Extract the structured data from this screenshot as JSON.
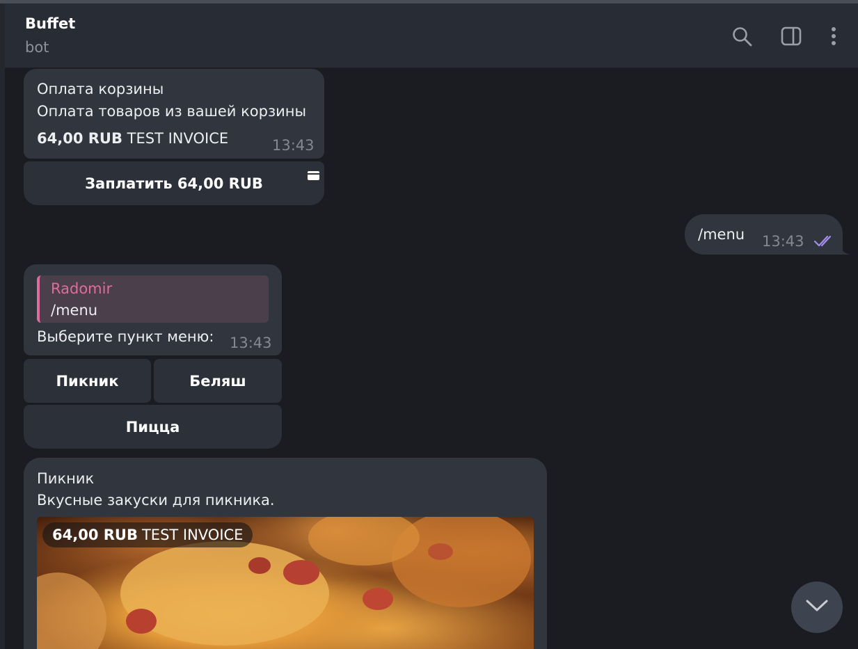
{
  "header": {
    "title": "Buffet",
    "subtitle": "bot",
    "icons": [
      "search-icon",
      "sidebar-toggle-icon",
      "more-vertical-icon"
    ]
  },
  "invoice_cart": {
    "title": "Оплата корзины",
    "description": "Оплата товаров из вашей корзины",
    "amount": "64,00 RUB",
    "invoice_label": "TEST INVOICE",
    "time": "13:43",
    "pay_button": "Заплатить 64,00 RUB"
  },
  "outgoing": {
    "text": "/menu",
    "time": "13:43",
    "status_icon": "double-check-icon"
  },
  "menu_message": {
    "reply_author": "Radomir",
    "reply_text": "/menu",
    "text": "Выберите пункт меню:",
    "time": "13:43",
    "buttons": [
      "Пикник",
      "Беляш",
      "Пицца"
    ]
  },
  "invoice_picnic": {
    "title": "Пикник",
    "description": "Вкусные закуски для пикника.",
    "amount": "64,00 RUB",
    "invoice_label": "TEST INVOICE"
  },
  "colors": {
    "accent": "#a48ef0",
    "reply_author": "#e06c9f",
    "background": "#1a1c21",
    "bubble": "#31353d"
  }
}
